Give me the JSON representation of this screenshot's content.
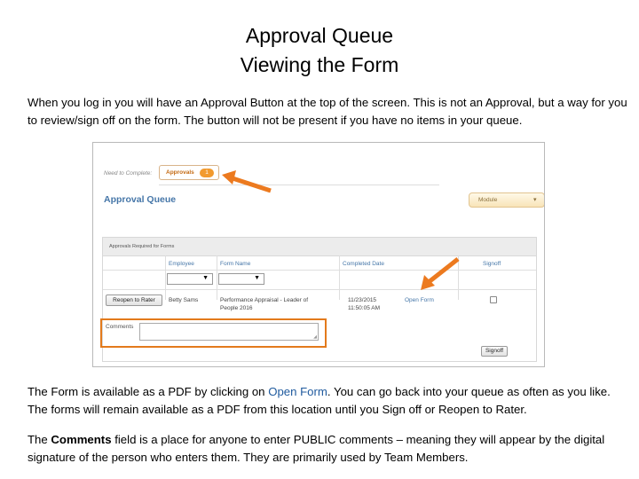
{
  "title_line1": "Approval Queue",
  "title_line2": "Viewing the Form",
  "intro": "When you log in you will have an Approval Button at the top of the screen. This is not an Approval, but a way for you to review/sign off on the form. The button will not be present if you have no items in your queue.",
  "screenshot": {
    "need_to_complete": "Need to Complete:",
    "approvals_label": "Approvals",
    "approvals_count": "1",
    "queue_title": "Approval Queue",
    "module_label": "Module",
    "module_caret": "▾",
    "table_caption": "Approvals Required for Forms",
    "columns": [
      "Employee",
      "Form Name",
      "Completed Date",
      "Signoff"
    ],
    "row": {
      "reopen_button": "Reopen to Rater",
      "employee": "Betty Sams",
      "form_name_line1": "Performance Appraisal - Leader of",
      "form_name_line2": "People 2016",
      "completed_date_line1": "11/23/2015",
      "completed_date_line2": "11:50:05 AM",
      "open_form_link": "Open Form"
    },
    "comments_label": "Comments",
    "signoff_button": "Signoff"
  },
  "para2_a": "The Form is available as a PDF by clicking on ",
  "para2_link": "Open Form",
  "para2_b": ".  You can go back into your queue as often as you like. The forms will remain available as a PDF from this location until you Sign off or Reopen to Rater.",
  "para3_a": "The ",
  "para3_bold": "Comments",
  "para3_b": " field is a place for anyone to enter PUBLIC comments – meaning they will appear by the digital signature of the person who enters them.  They are primarily used by Team Members.",
  "colors": {
    "arrow": "#ec7a1f",
    "accent_blue": "#4576a8",
    "highlight": "#e37a1c"
  }
}
